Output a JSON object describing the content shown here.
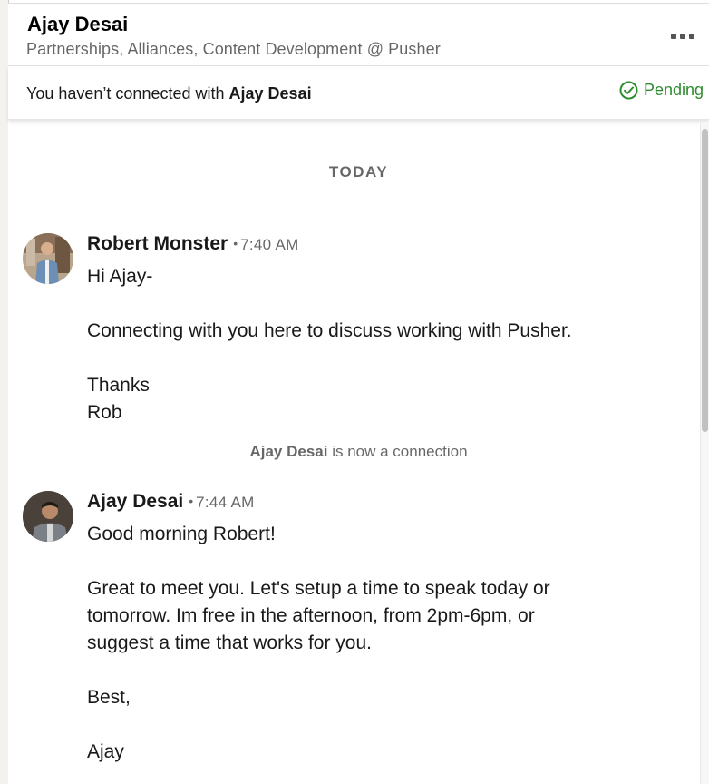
{
  "header": {
    "name": "Ajay Desai",
    "headline": "Partnerships, Alliances, Content Development @ Pusher",
    "more_icon": "ellipsis-icon"
  },
  "connection_bar": {
    "notice_prefix": "You haven’t connected with",
    "notice_name": "Ajay Desai",
    "status_label": "Pending",
    "status_icon": "check-circle-icon",
    "status_color": "#2e8b2e"
  },
  "thread": {
    "date_divider": "TODAY",
    "messages": [
      {
        "sender": "Robert Monster",
        "time": "7:40 AM",
        "lines": [
          "Hi Ajay-",
          "",
          "Connecting with you here to discuss working with Pusher.",
          "",
          "Thanks",
          "Rob"
        ]
      },
      {
        "sender": "Ajay Desai",
        "time": "7:44 AM",
        "lines": [
          "Good morning Robert!",
          "",
          "Great to meet you. Let's setup a time to speak today or",
          "tomorrow. Im free in the afternoon, from 2pm-6pm, or",
          "suggest a time that works for you.",
          "",
          "Best,",
          "",
          "Ajay"
        ]
      }
    ],
    "system_note": {
      "name": "Ajay Desai",
      "text": "is now a connection"
    }
  }
}
